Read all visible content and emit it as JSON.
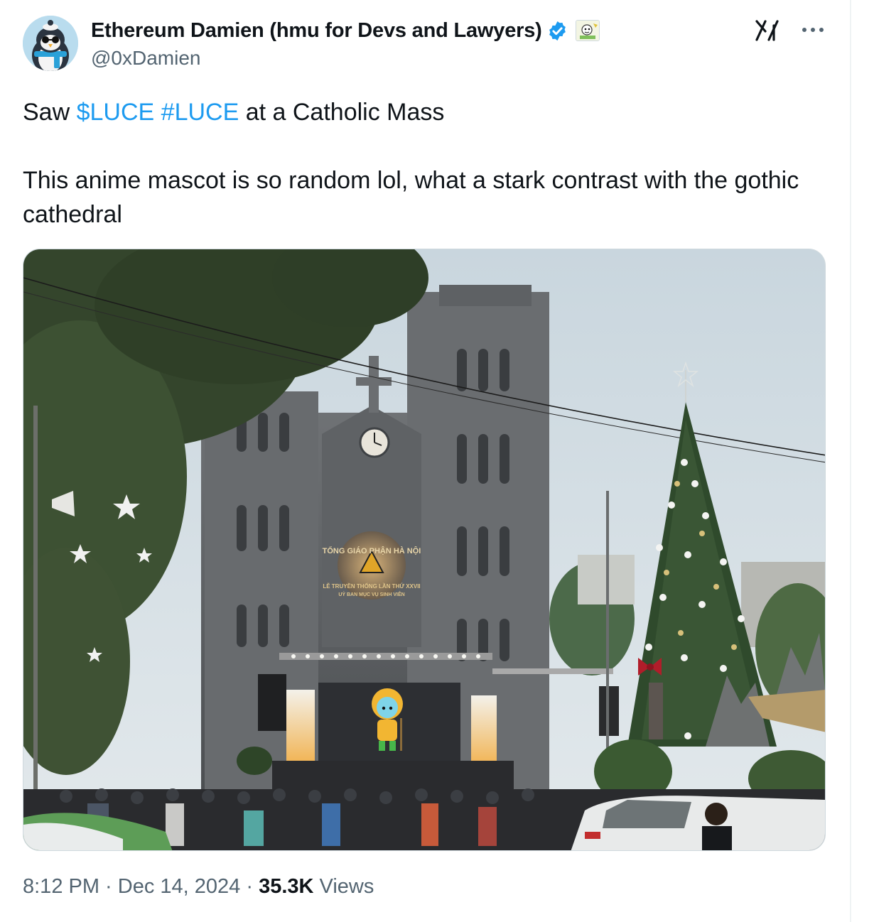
{
  "author": {
    "display_name": "Ethereum Damien (hmu for Devs and Lawyers)",
    "handle": "@0xDamien",
    "verified_color": "#1d9bf0"
  },
  "tweet": {
    "line1_prefix": "Saw ",
    "cashtag": "$LUCE",
    "space": " ",
    "hashtag": "#LUCE",
    "line1_suffix": " at a Catholic Mass",
    "line2": "This anime mascot is so random lol, what a stark contrast with the gothic cathedral"
  },
  "photo_text": {
    "banner_top": "TỔNG GIÁO PHẬN HÀ NỘI",
    "banner_line1": "LỄ TRUYỀN THỐNG LẦN THỨ XXVII",
    "banner_line2": "UỶ BAN MỤC VỤ SINH VIÊN"
  },
  "meta": {
    "time": "8:12 PM",
    "separator": " · ",
    "date": "Dec 14, 2024",
    "views_count": "35.3K",
    "views_label": " Views"
  },
  "icons": {
    "grok": "grok-icon",
    "more": "more-icon",
    "verified": "verified-badge-icon",
    "affiliate": "affiliate-badge-icon"
  },
  "colors": {
    "link": "#1d9bf0",
    "secondary_text": "#536471",
    "primary_text": "#0f1419"
  }
}
